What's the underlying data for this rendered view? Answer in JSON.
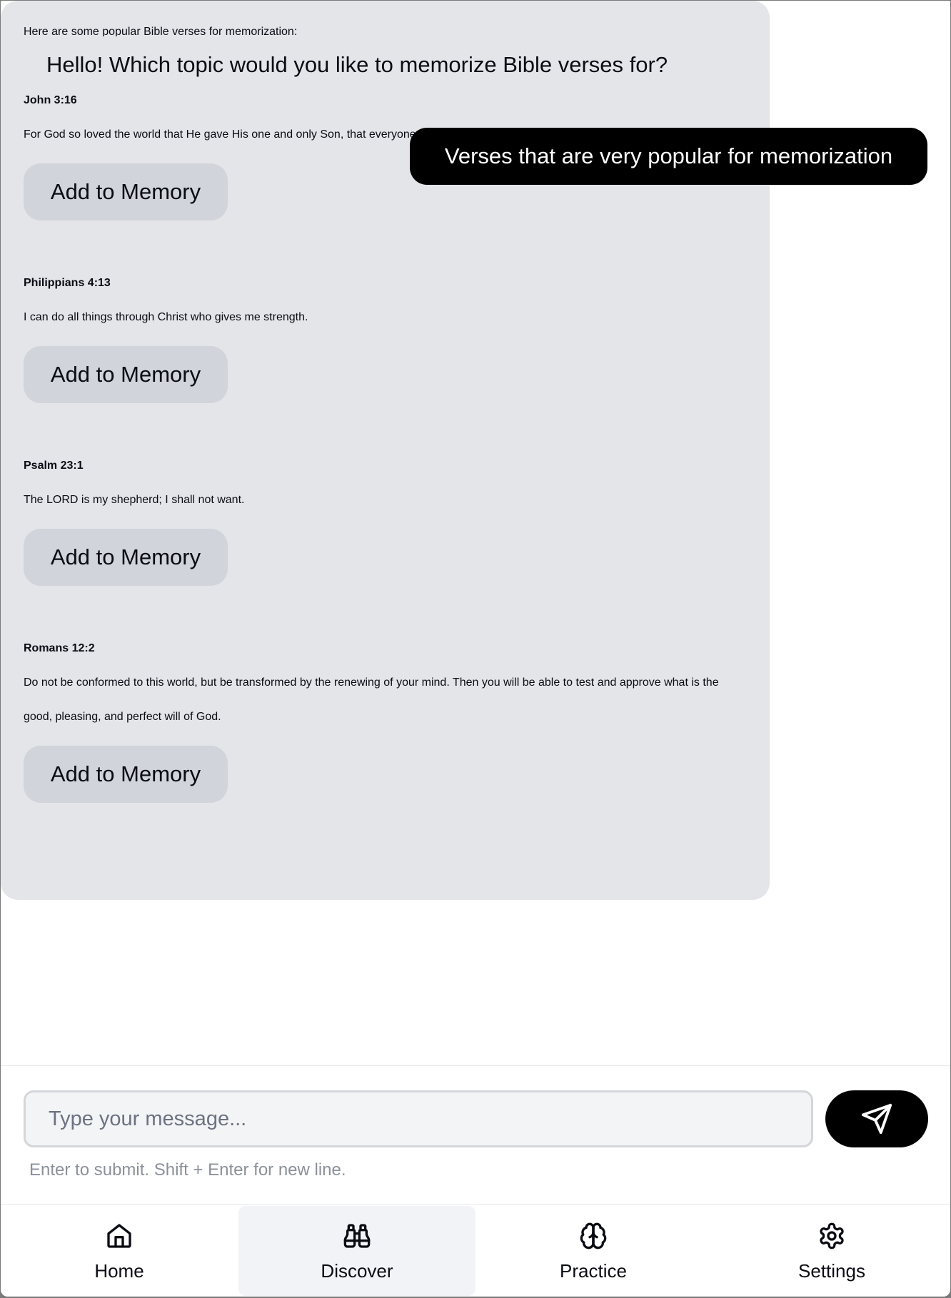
{
  "chat": {
    "greeting": "Hello! Which topic would you like to memorize Bible verses for?",
    "user_message": "Verses that are very popular for memorization",
    "intro": "Here are some popular Bible verses for memorization:",
    "verses": [
      {
        "reference": "John 3:16",
        "text": "For God so loved the world that He gave His one and only Son, that everyone who believes in Him shall not perish but have eternal life.",
        "button_label": "Add to Memory"
      },
      {
        "reference": "Philippians 4:13",
        "text": "I can do all things through Christ who gives me strength.",
        "button_label": "Add to Memory"
      },
      {
        "reference": "Psalm 23:1",
        "text": "The LORD is my shepherd; I shall not want.",
        "button_label": "Add to Memory"
      },
      {
        "reference": "Romans 12:2",
        "text": "Do not be conformed to this world, but be transformed by the renewing of your mind. Then you will be able to test and approve what is the good, pleasing, and perfect will of God.",
        "button_label": "Add to Memory"
      }
    ]
  },
  "composer": {
    "placeholder": "Type your message...",
    "value": "",
    "hint": "Enter to submit. Shift + Enter for new line.",
    "send_icon": "send-icon"
  },
  "nav": {
    "active": "Discover",
    "items": [
      {
        "label": "Home",
        "icon": "home-icon"
      },
      {
        "label": "Discover",
        "icon": "binoculars-icon"
      },
      {
        "label": "Practice",
        "icon": "brain-icon"
      },
      {
        "label": "Settings",
        "icon": "gear-icon"
      }
    ]
  },
  "colors": {
    "bot_bubble": "#e4e5e9",
    "user_bubble": "#000000",
    "button_bg": "#d1d4da",
    "active_nav_bg": "#f1f3f7",
    "hint_text": "#8b909a"
  }
}
